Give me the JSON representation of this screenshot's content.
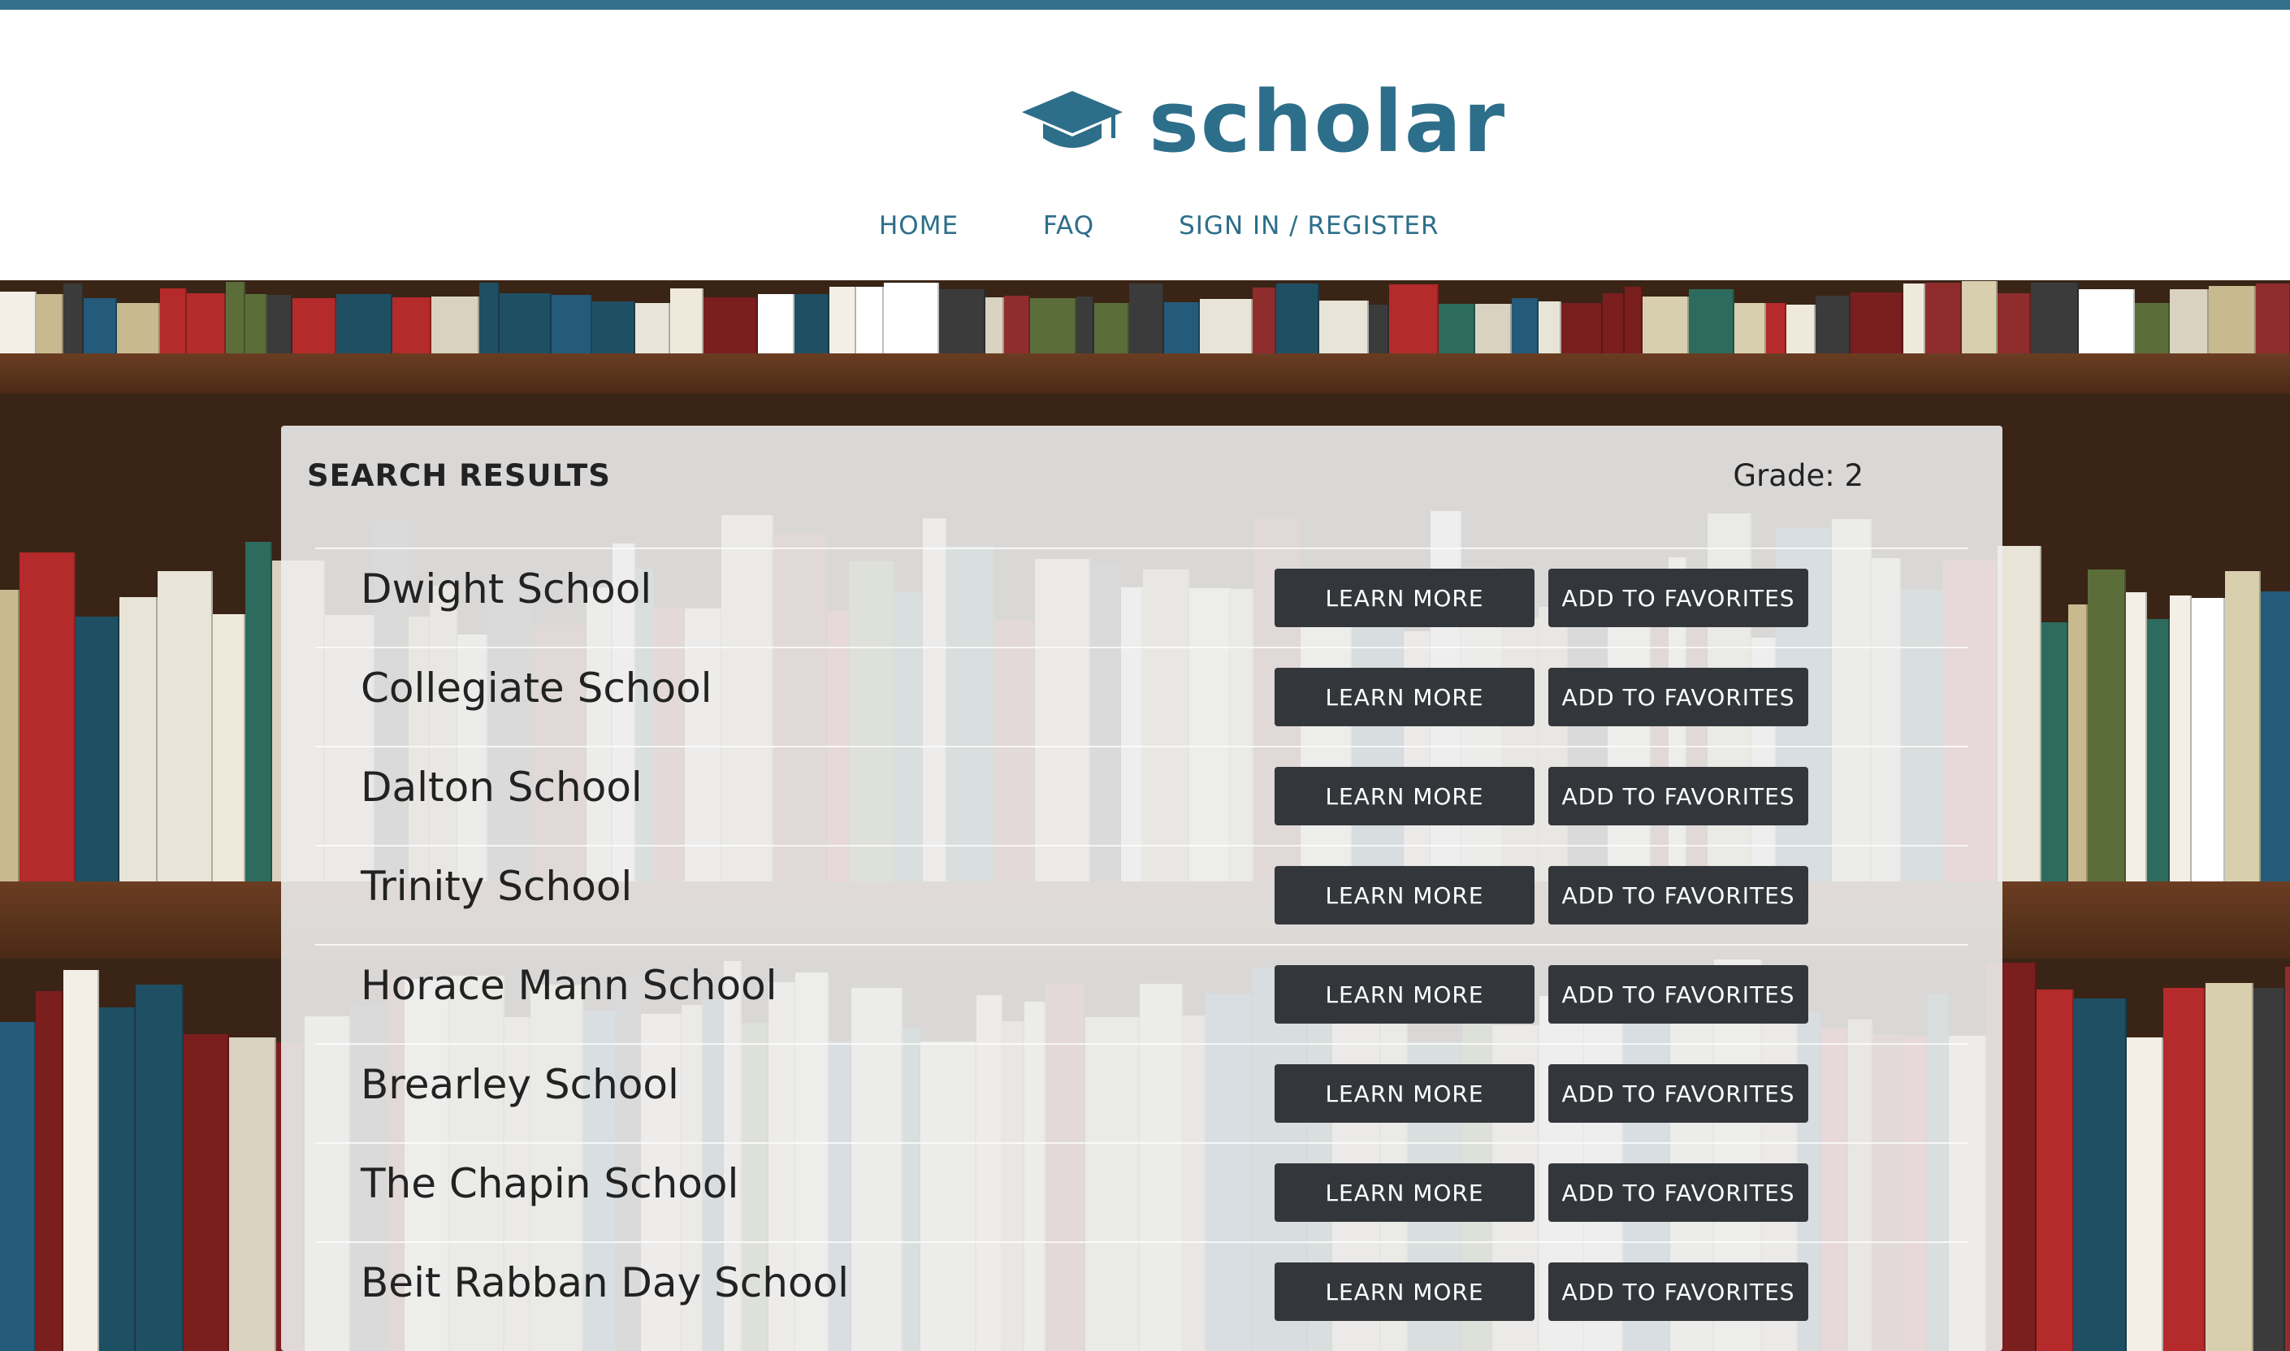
{
  "brand": {
    "name": "scholar",
    "logo_icon": "graduation-cap-icon"
  },
  "nav": {
    "home": "HOME",
    "faq": "FAQ",
    "signin": "SIGN IN / REGISTER"
  },
  "results": {
    "title": "SEARCH RESULTS",
    "grade": "Grade: 2",
    "learn_label": "LEARN MORE",
    "fav_label": "ADD TO FAVORITES",
    "schools": [
      "Dwight School",
      "Collegiate School",
      "Dalton School",
      "Trinity School",
      "Horace Mann School",
      "Brearley School",
      "The Chapin School",
      "Beit Rabban Day School"
    ]
  },
  "colors": {
    "accent": "#2d6e8a",
    "top_rule": "#33708c",
    "button_bg": "#33363b",
    "button_text": "#ffffff"
  }
}
